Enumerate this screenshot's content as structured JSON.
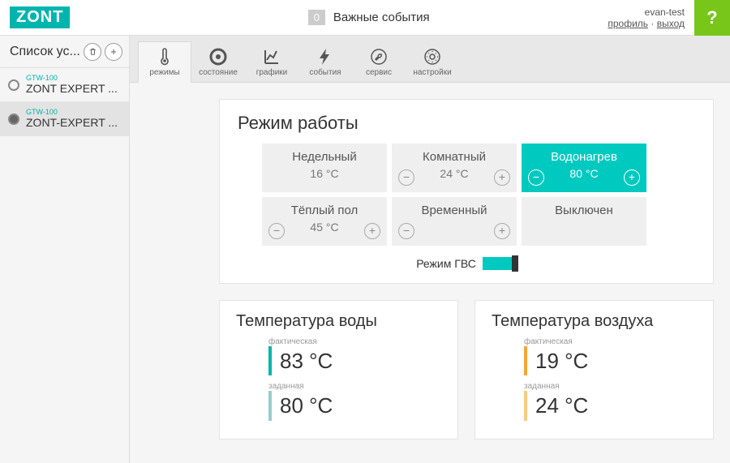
{
  "header": {
    "logo": "ZONT",
    "events_count": "0",
    "events_label": "Важные события",
    "username": "evan-test",
    "profile_link": "профиль",
    "logout_link": "выход"
  },
  "sidebar": {
    "title": "Список ус...",
    "devices": [
      {
        "model": "GTW-100",
        "name": "ZONT EXPERT ..."
      },
      {
        "model": "GTW-100",
        "name": "ZONT-EXPERT ..."
      }
    ]
  },
  "tabs": [
    {
      "id": "modes",
      "label": "режимы"
    },
    {
      "id": "state",
      "label": "состояние"
    },
    {
      "id": "charts",
      "label": "графики"
    },
    {
      "id": "events",
      "label": "события"
    },
    {
      "id": "service",
      "label": "сервис"
    },
    {
      "id": "settings",
      "label": "настройки"
    }
  ],
  "mode_card": {
    "title": "Режим работы",
    "modes": [
      {
        "name": "Недельный",
        "temp": "16 °C",
        "has_controls": false
      },
      {
        "name": "Комнатный",
        "temp": "24 °C",
        "has_controls": true
      },
      {
        "name": "Водонагрев",
        "temp": "80 °C",
        "has_controls": true,
        "active": true
      },
      {
        "name": "Тёплый пол",
        "temp": "45 °C",
        "has_controls": true
      },
      {
        "name": "Временный",
        "temp": "",
        "has_controls": true
      },
      {
        "name": "Выключен",
        "temp": "",
        "has_controls": false
      }
    ],
    "gvs_label": "Режим ГВС"
  },
  "water_temp": {
    "title": "Температура воды",
    "actual_label": "фактическая",
    "actual_value": "83 °C",
    "target_label": "заданная",
    "target_value": "80 °C"
  },
  "air_temp": {
    "title": "Температура воздуха",
    "actual_label": "фактическая",
    "actual_value": "19 °C",
    "target_label": "заданная",
    "target_value": "24 °C"
  }
}
